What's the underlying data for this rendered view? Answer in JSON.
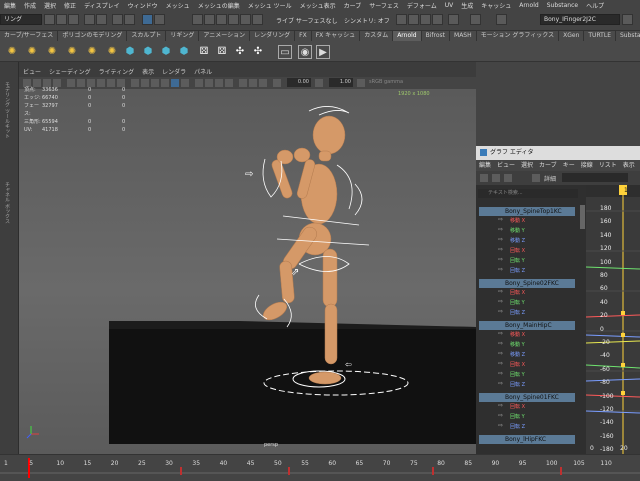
{
  "menubar": {
    "items": [
      "編集",
      "作成",
      "選択",
      "修正",
      "ディスプレイ",
      "ウィンドウ",
      "メッシュ",
      "メッシュの編集",
      "メッシュ ツール",
      "メッシュ表示",
      "カーブ",
      "サーフェス",
      "デフォーム",
      "UV",
      "生成",
      "キャッシュ",
      "Arnold",
      "Substance",
      "ヘルプ"
    ]
  },
  "statusline": {
    "mode_dropdown": "リング",
    "live_surface": "ライブ サーフェスなし",
    "symmetry": "シンメトリ: オフ",
    "selected_object": "Bony_IFinger2J2C"
  },
  "shelf_tabs": {
    "items": [
      "カーブ/サーフェス",
      "ポリゴンのモデリング",
      "スカルプト",
      "リギング",
      "アニメーション",
      "レンダリング",
      "FX",
      "FX キャッシュ",
      "カスタム",
      "Arnold",
      "Bifrost",
      "MASH",
      "モーション グラフィックス",
      "XGen",
      "TURTLE",
      "Substance"
    ],
    "active_index": 9
  },
  "viewport": {
    "menu": [
      "ビュー",
      "シェーディング",
      "ライティング",
      "表示",
      "レンダラ",
      "パネル"
    ],
    "exposure": "0.00",
    "gamma": "1.00",
    "color_space": "sRGB gamma",
    "resolution": "1920 x 1080",
    "camera": "persp",
    "hud": [
      {
        "label": "頂点:",
        "a": "33636",
        "b": "0",
        "c": "0"
      },
      {
        "label": "エッジ:",
        "a": "66740",
        "b": "0",
        "c": "0"
      },
      {
        "label": "フェース:",
        "a": "32797",
        "b": "0",
        "c": "0"
      },
      {
        "label": "三角形:",
        "a": "65594",
        "b": "0",
        "c": "0"
      },
      {
        "label": "UV:",
        "a": "41718",
        "b": "0",
        "c": "0"
      }
    ]
  },
  "toolbox": {
    "side_labels": [
      "モデリング ツールキット",
      "チャネル ボックス"
    ]
  },
  "graph_editor": {
    "title": "グラフ エディタ",
    "menu": [
      "編集",
      "ビュー",
      "選択",
      "カーブ",
      "キー",
      "接線",
      "リスト",
      "表示"
    ],
    "detail_label": "詳細",
    "search_placeholder": "テキスト検索...",
    "nodes": [
      {
        "name": "Bony_SpineTop1KC",
        "channels": [
          {
            "label": "移動 X",
            "axis": "x"
          },
          {
            "label": "移動 Y",
            "axis": "y"
          },
          {
            "label": "移動 Z",
            "axis": "z"
          },
          {
            "label": "回転 X",
            "axis": "x"
          },
          {
            "label": "回転 Y",
            "axis": "y"
          },
          {
            "label": "回転 Z",
            "axis": "z"
          }
        ]
      },
      {
        "name": "Bony_Spine02FKC",
        "channels": [
          {
            "label": "回転 X",
            "axis": "x"
          },
          {
            "label": "回転 Y",
            "axis": "y"
          },
          {
            "label": "回転 Z",
            "axis": "z"
          }
        ]
      },
      {
        "name": "Bony_MainHipC",
        "channels": [
          {
            "label": "移動 X",
            "axis": "x"
          },
          {
            "label": "移動 Y",
            "axis": "y"
          },
          {
            "label": "移動 Z",
            "axis": "z"
          },
          {
            "label": "回転 X",
            "axis": "x"
          },
          {
            "label": "回転 Y",
            "axis": "y"
          },
          {
            "label": "回転 Z",
            "axis": "z"
          }
        ]
      },
      {
        "name": "Bony_Spine01FKC",
        "channels": [
          {
            "label": "回転 X",
            "axis": "x"
          },
          {
            "label": "回転 Y",
            "axis": "y"
          },
          {
            "label": "回転 Z",
            "axis": "z"
          }
        ]
      },
      {
        "name": "Bony_lHipFKC",
        "channels": []
      }
    ],
    "current_frame": "1",
    "value_labels": [
      "180",
      "160",
      "140",
      "120",
      "100",
      "80",
      "60",
      "40",
      "20",
      "0",
      "-20",
      "-40",
      "-60",
      "-80",
      "-100",
      "-120",
      "-140",
      "-160",
      "-180"
    ],
    "bottom_ruler": [
      "0",
      "20"
    ]
  },
  "timeline": {
    "ticks": [
      "1",
      "5",
      "10",
      "15",
      "20",
      "25",
      "30",
      "35",
      "40",
      "45",
      "50",
      "55",
      "60",
      "65",
      "70",
      "75",
      "80",
      "85",
      "90",
      "95",
      "100",
      "105",
      "110"
    ],
    "colors": {
      "key": "#c03030",
      "playhead": "#ff0000"
    }
  }
}
